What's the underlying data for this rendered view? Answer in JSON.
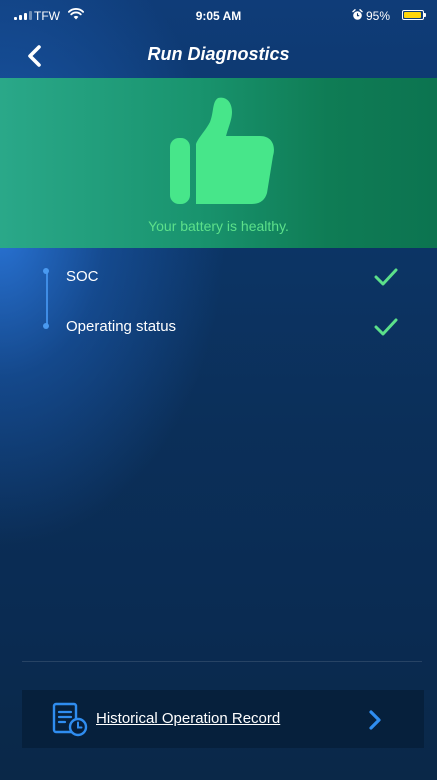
{
  "status_bar": {
    "carrier": "TFW",
    "time": "9:05 AM",
    "battery_percent": "95%",
    "battery_level": 0.95
  },
  "nav": {
    "title": "Run Diagnostics",
    "back_icon": "chevron-left-icon"
  },
  "hero": {
    "icon": "thumbs-up-icon",
    "message": "Your battery is healthy."
  },
  "checks": [
    {
      "label": "SOC",
      "status_icon": "checkmark-icon"
    },
    {
      "label": "Operating status",
      "status_icon": "checkmark-icon"
    }
  ],
  "footer": {
    "history_label": "Historical Operation Record",
    "history_icon": "record-history-icon",
    "chevron_icon": "chevron-right-icon"
  },
  "colors": {
    "accent_green": "#5ce08a",
    "hero_green": "#17926c",
    "accent_blue": "#2f8df0",
    "background": "#0b2f59"
  }
}
